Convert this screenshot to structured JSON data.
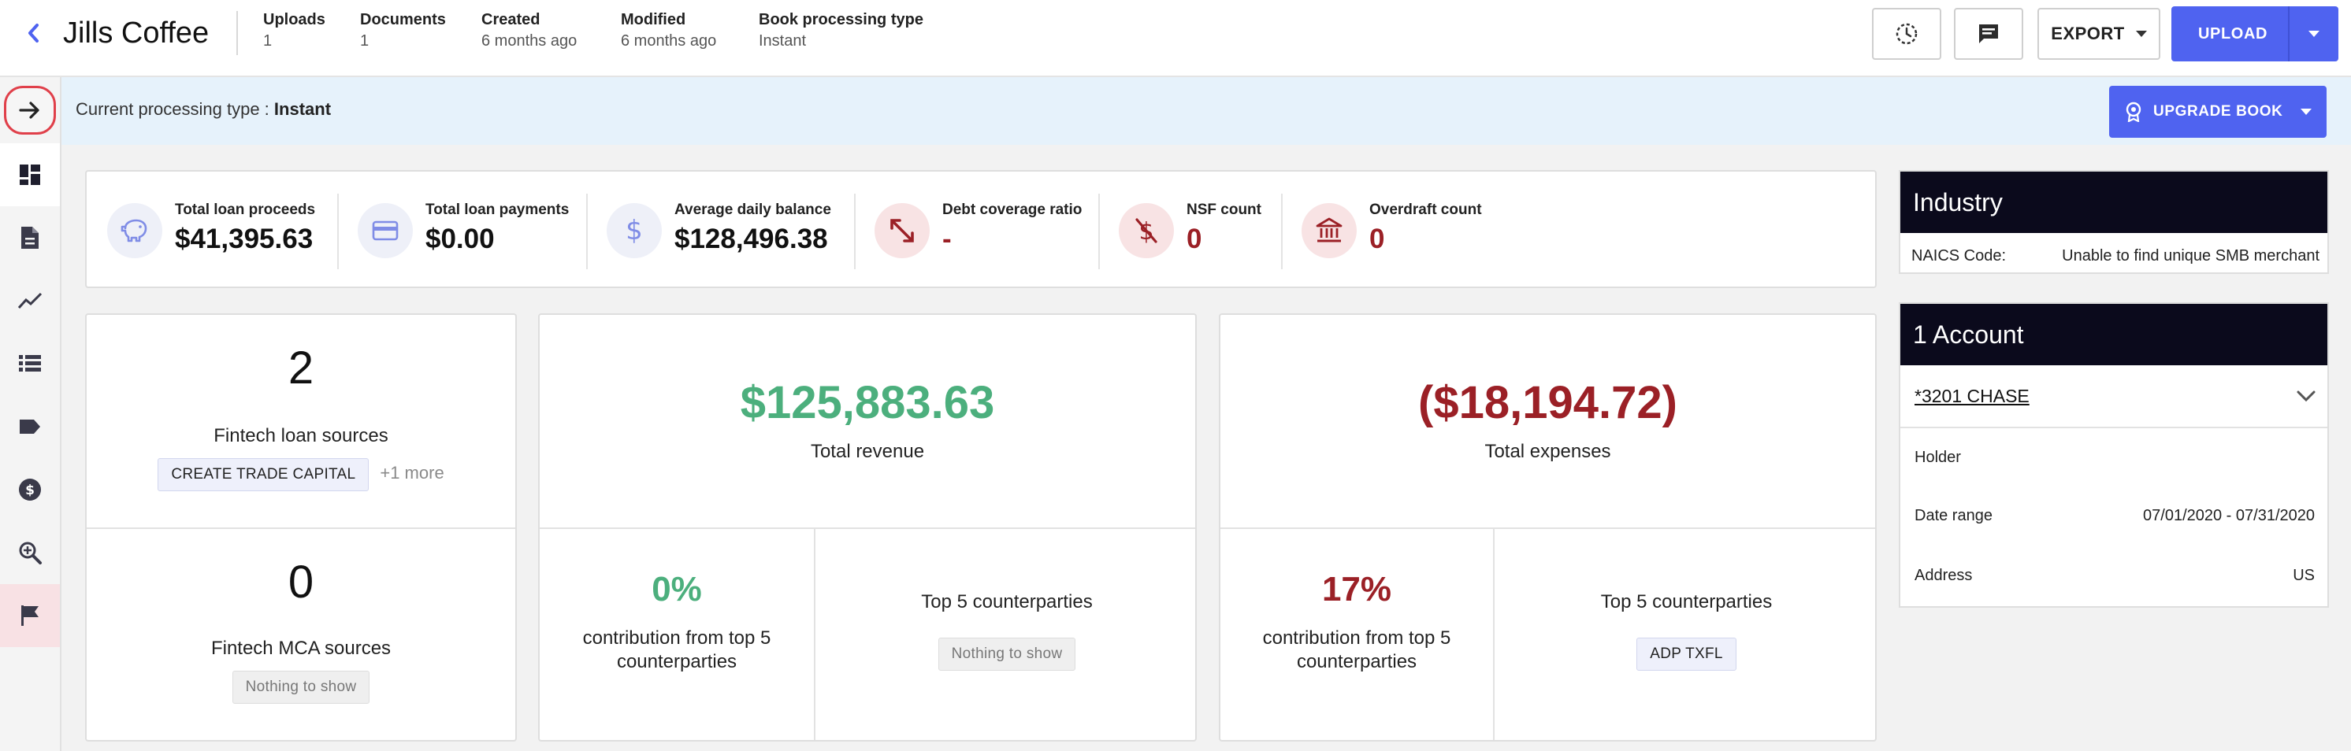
{
  "header": {
    "title": "Jills Coffee",
    "meta": [
      {
        "label": "Uploads",
        "value": "1"
      },
      {
        "label": "Documents",
        "value": "1"
      },
      {
        "label": "Created",
        "value": "6 months ago"
      },
      {
        "label": "Modified",
        "value": "6 months ago"
      },
      {
        "label": "Book processing type",
        "value": "Instant"
      }
    ],
    "export_label": "EXPORT",
    "upload_label": "UPLOAD"
  },
  "sidebar": {
    "items": [
      {
        "icon": "arrow-right-icon"
      },
      {
        "icon": "dashboard-icon"
      },
      {
        "icon": "document-icon"
      },
      {
        "icon": "trend-line-icon"
      },
      {
        "icon": "list-icon"
      },
      {
        "icon": "tag-icon"
      },
      {
        "icon": "dollar-circle-icon"
      },
      {
        "icon": "zoom-search-icon"
      },
      {
        "icon": "flag-icon"
      }
    ]
  },
  "banner": {
    "text": "Current processing type : ",
    "value": "Instant",
    "upgrade_label": "UPGRADE BOOK"
  },
  "metrics": [
    {
      "label": "Total loan proceeds",
      "value": "$41,395.63",
      "icon": "piggy-bank-icon"
    },
    {
      "label": "Total loan payments",
      "value": "$0.00",
      "icon": "credit-card-icon"
    },
    {
      "label": "Average daily balance",
      "value": "$128,496.38",
      "icon": "dollar-icon"
    },
    {
      "label": "Debt coverage ratio",
      "value": "-",
      "icon": "ratio-arrows-icon"
    },
    {
      "label": "NSF count",
      "value": "0",
      "icon": "no-money-icon"
    },
    {
      "label": "Overdraft count",
      "value": "0",
      "icon": "bank-icon"
    }
  ],
  "fintech": {
    "loan_count": "2",
    "loan_label": "Fintech loan sources",
    "loan_chip": "CREATE TRADE CAPITAL",
    "loan_more": "+1 more",
    "mca_count": "0",
    "mca_label": "Fintech MCA sources",
    "mca_chip": "Nothing to show"
  },
  "revenue": {
    "amount": "$125,883.63",
    "label": "Total revenue",
    "pct": "0%",
    "pct_label": "contribution from top 5 counterparties",
    "top_label": "Top 5 counterparties",
    "top_chip": "Nothing to show"
  },
  "expenses": {
    "amount": "($18,194.72)",
    "label": "Total expenses",
    "pct": "17%",
    "pct_label": "contribution from top 5 counterparties",
    "top_label": "Top 5 counterparties",
    "top_chip": "ADP TXFL"
  },
  "industry": {
    "title": "Industry",
    "naics_label": "NAICS Code:",
    "naics_value": "Unable to find unique SMB merchant"
  },
  "account": {
    "title": "1 Account",
    "name": "*3201 CHASE",
    "holder_label": "Holder",
    "holder_value": "",
    "date_label": "Date range",
    "date_value": "07/01/2020 - 07/31/2020",
    "address_label": "Address",
    "address_value": "US"
  },
  "colors": {
    "accent": "#4f63f0",
    "positive": "#4caf7d",
    "negative": "#9b2026",
    "banner": "#e6f2fb"
  }
}
